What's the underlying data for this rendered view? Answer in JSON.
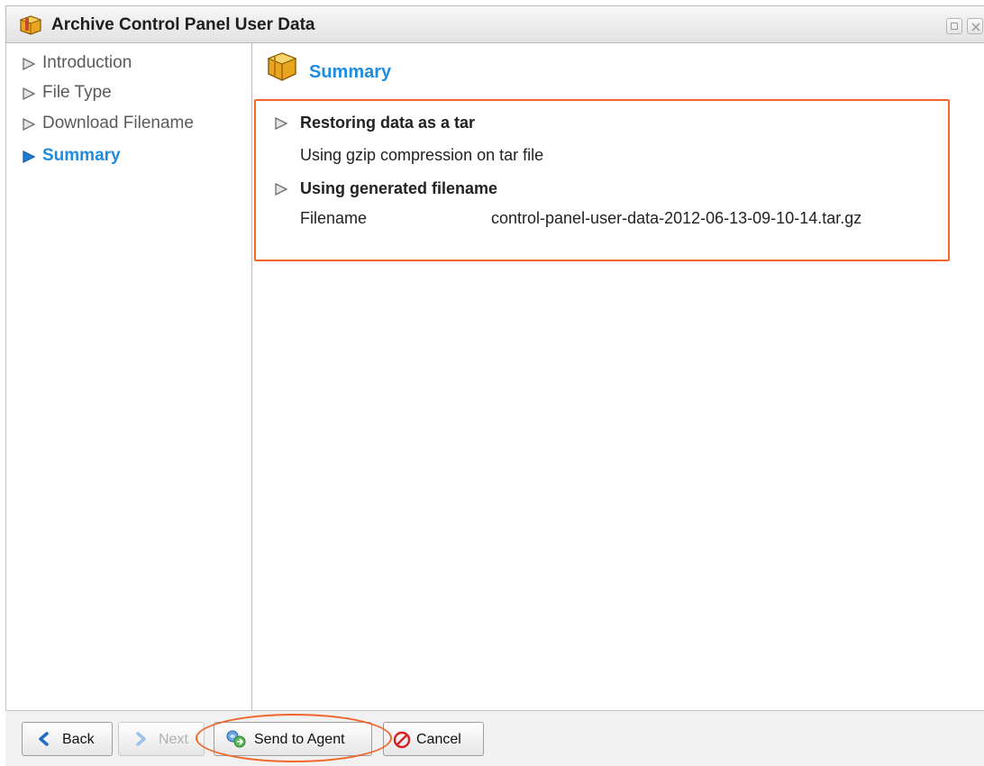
{
  "window": {
    "title": "Archive Control Panel User Data",
    "title_icon": "archive-box-icon"
  },
  "sidebar": {
    "items": [
      {
        "label": "Introduction",
        "active": false
      },
      {
        "label": "File Type",
        "active": false
      },
      {
        "label": "Download Filename",
        "active": false
      },
      {
        "label": "Summary",
        "active": true
      }
    ]
  },
  "content": {
    "section_title": "Summary",
    "section_icon": "archive-box-icon",
    "summary": {
      "item1_heading": "Restoring data as a tar",
      "item1_detail": "Using gzip compression on tar file",
      "item2_heading": "Using generated filename",
      "filename_label": "Filename",
      "filename_value": "control-panel-user-data-2012-06-13-09-10-14.tar.gz"
    }
  },
  "toolbar": {
    "back_label": "Back",
    "next_label": "Next",
    "send_label": "Send to Agent",
    "cancel_label": "Cancel"
  },
  "colors": {
    "accent": "#1f8ce0",
    "highlight": "#f0662a",
    "cancel_red": "#d82020"
  }
}
